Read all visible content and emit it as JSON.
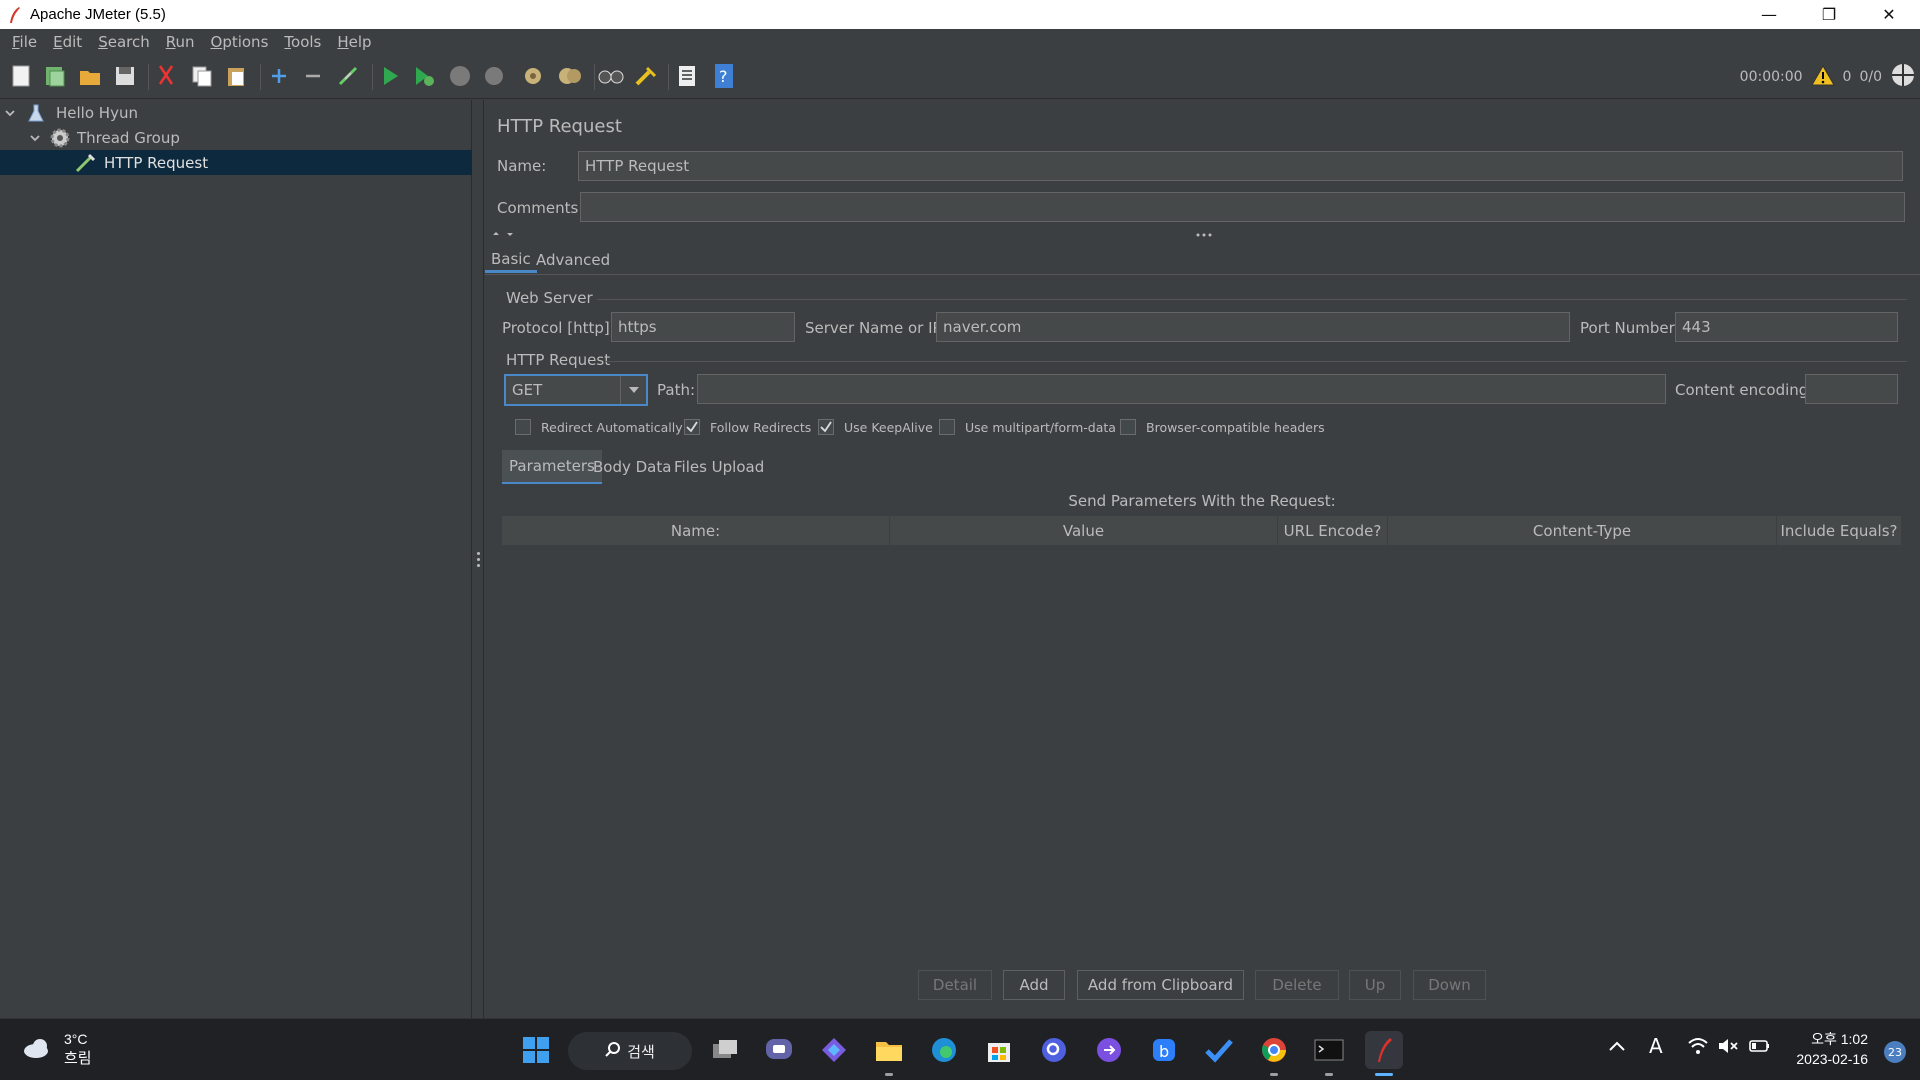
{
  "window": {
    "title": "Apache JMeter (5.5)",
    "minimize": "—",
    "restore": "❐",
    "close": "✕"
  },
  "menu": [
    {
      "label": "File",
      "mnemonic": "F",
      "rest": "ile"
    },
    {
      "label": "Edit",
      "mnemonic": "E",
      "rest": "dit"
    },
    {
      "label": "Search",
      "mnemonic": "S",
      "rest": "earch"
    },
    {
      "label": "Run",
      "mnemonic": "R",
      "rest": "un"
    },
    {
      "label": "Options",
      "mnemonic": "O",
      "rest": "ptions"
    },
    {
      "label": "Tools",
      "mnemonic": "T",
      "rest": "ools"
    },
    {
      "label": "Help",
      "mnemonic": "H",
      "rest": "elp"
    }
  ],
  "toolbar": {
    "icons": [
      "new-icon",
      "templates-icon",
      "open-icon",
      "save-icon",
      "cut-icon",
      "copy-icon",
      "paste-icon",
      "expand-icon",
      "collapse-icon",
      "toggle-icon",
      "start-icon",
      "start-no-pause-icon",
      "stop-icon",
      "shutdown-icon",
      "clear-icon",
      "clear-all-icon",
      "search-icon",
      "reset-search-icon",
      "function-helper-icon",
      "help-icon"
    ],
    "elapsed": "00:00:00",
    "warnings": "0",
    "threads": "0/0"
  },
  "tree": {
    "root": "Hello Hyun",
    "thread_group": "Thread Group",
    "sampler": "HTTP Request"
  },
  "panel": {
    "title": "HTTP Request",
    "name_label": "Name:",
    "name_value": "HTTP Request",
    "comments_label": "Comments:",
    "comments_value": "",
    "tabs": [
      "Basic",
      "Advanced"
    ],
    "web_server": {
      "title": "Web Server",
      "protocol_label": "Protocol [http]:",
      "protocol_value": "https",
      "server_label": "Server Name or IP:",
      "server_value": "naver.com",
      "port_label": "Port Number:",
      "port_value": "443"
    },
    "http_request": {
      "title": "HTTP Request",
      "method": "GET",
      "path_label": "Path:",
      "path_value": "",
      "encoding_label": "Content encoding:",
      "encoding_value": ""
    },
    "checkboxes": [
      {
        "label": "Redirect Automatically",
        "checked": false
      },
      {
        "label": "Follow Redirects",
        "checked": true
      },
      {
        "label": "Use KeepAlive",
        "checked": true
      },
      {
        "label": "Use multipart/form-data",
        "checked": false
      },
      {
        "label": "Browser-compatible headers",
        "checked": false
      }
    ],
    "subtabs": [
      "Parameters",
      "Body Data",
      "Files Upload"
    ],
    "table_caption": "Send Parameters With the Request:",
    "columns": [
      "Name:",
      "Value",
      "URL Encode?",
      "Content-Type",
      "Include Equals?"
    ],
    "buttons": [
      {
        "label": "Detail",
        "enabled": false
      },
      {
        "label": "Add",
        "enabled": true
      },
      {
        "label": "Add from Clipboard",
        "enabled": true
      },
      {
        "label": "Delete",
        "enabled": false
      },
      {
        "label": "Up",
        "enabled": false
      },
      {
        "label": "Down",
        "enabled": false
      }
    ]
  },
  "taskbar": {
    "weather_temp": "3°C",
    "weather_desc": "흐림",
    "search_label": "검색",
    "time": "오후 1:02",
    "date": "2023-02-16",
    "notifications": "23",
    "ime": "A"
  },
  "colors": {
    "background": "#3c3f41",
    "field": "#45494a",
    "accent": "#4a88c7",
    "selection": "#0d293e",
    "taskbar": "#1f2125"
  }
}
